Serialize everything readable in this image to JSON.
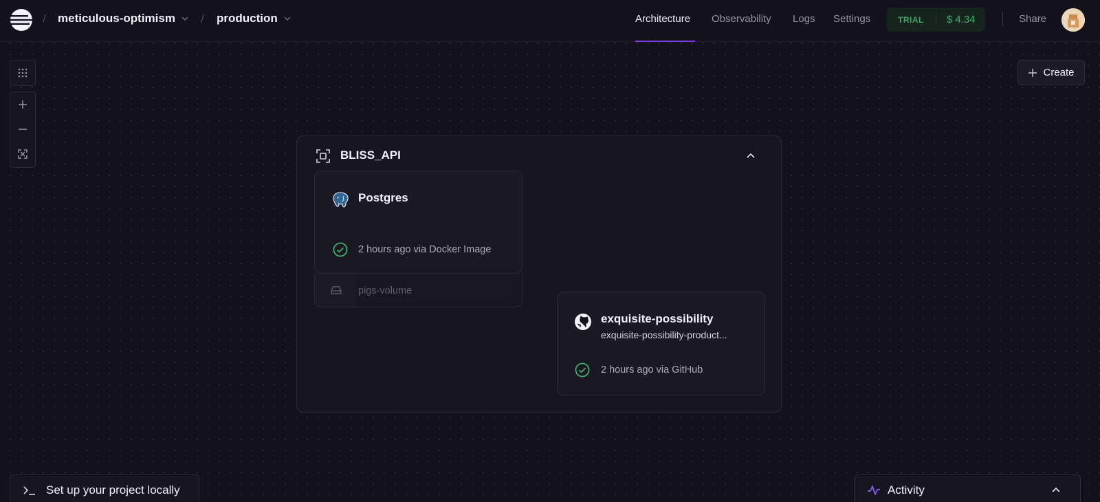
{
  "header": {
    "project_name": "meticulous-optimism",
    "environment": "production",
    "separator": "/",
    "nav": [
      {
        "label": "Architecture",
        "active": true
      },
      {
        "label": "Observability",
        "active": false
      },
      {
        "label": "Logs",
        "active": false
      },
      {
        "label": "Settings",
        "active": false
      }
    ],
    "trial_label": "TRIAL",
    "credit": "$ 4.34",
    "share_label": "Share"
  },
  "canvas_tools": {
    "grid_icon": "grid-dots-icon",
    "zoom_in_icon": "plus-icon",
    "zoom_out_icon": "minus-icon",
    "fit_icon": "fit-view-icon"
  },
  "create_label": "Create",
  "group": {
    "name": "BLISS_API",
    "services": [
      {
        "name": "Postgres",
        "icon": "postgres-elephant-icon",
        "status": "2 hours ago via Docker Image",
        "volume": "pigs-volume"
      },
      {
        "name": "exquisite-possibility",
        "icon": "github-icon",
        "subtitle": "exquisite-possibility-product...",
        "status": "2 hours ago via GitHub"
      }
    ]
  },
  "bottom": {
    "setup_label": "Set up your project locally",
    "activity_label": "Activity"
  },
  "colors": {
    "background": "#13111c",
    "accent_purple": "#7a3fe0",
    "success_green": "#3fb26a",
    "card_border": "#2d2a38"
  }
}
